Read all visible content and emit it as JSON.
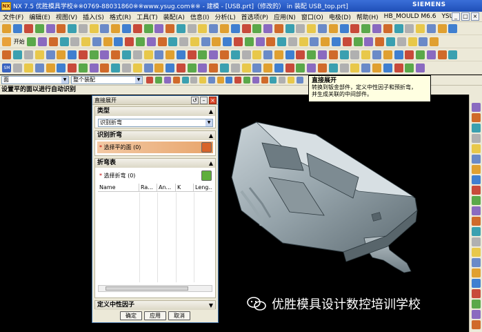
{
  "title_bar": {
    "logo_text": "NX",
    "title": "NX 7.5 优胜模具学校※※0769-88031860※※www.ysug.com※※ - 建模 - [USB.prt]（修改的） in 装配 USB_top.prt]",
    "brand": "SIEMENS"
  },
  "menu_bar": {
    "items": [
      "文件(F)",
      "编辑(E)",
      "视图(V)",
      "插入(S)",
      "格式(R)",
      "工具(T)",
      "装配(A)",
      "信息(I)",
      "分析(L)",
      "首选项(P)",
      "应用(N)",
      "窗口(O)",
      "电极(D)",
      "帮助(H)",
      "HB_MOULD M6.6",
      "YSUG"
    ],
    "window_controls": [
      "_",
      "□",
      "×"
    ]
  },
  "toolbars": {
    "start_label": "开始",
    "row3_label": "SM"
  },
  "selection_bar": {
    "filter": "面",
    "scope": "整个装配"
  },
  "status_bar": {
    "prompt": "设置平的面以进行自动识别"
  },
  "tooltip": {
    "title": "直接展开",
    "line1": "转换到钣金部件，定义中性因子和预折弯，",
    "line2": "并生成关联的中间部件。"
  },
  "dialog": {
    "title": "直接展开",
    "type_group": {
      "label": "类型",
      "value": "识别折弯"
    },
    "identify_group": {
      "label": "识别折弯",
      "select_face": "选择平的面 (0)"
    },
    "bend_table_group": {
      "label": "折弯表",
      "select_bend": "选择折弯 (0)",
      "columns": [
        "Name",
        "Ra...",
        "An...",
        "K",
        "Leng..."
      ]
    },
    "neutral_factor_label": "定义中性因子",
    "buttons": {
      "ok": "确定",
      "apply": "应用",
      "cancel": "取消"
    }
  },
  "watermark": {
    "text": "优胜模具设计数控培训学校"
  }
}
